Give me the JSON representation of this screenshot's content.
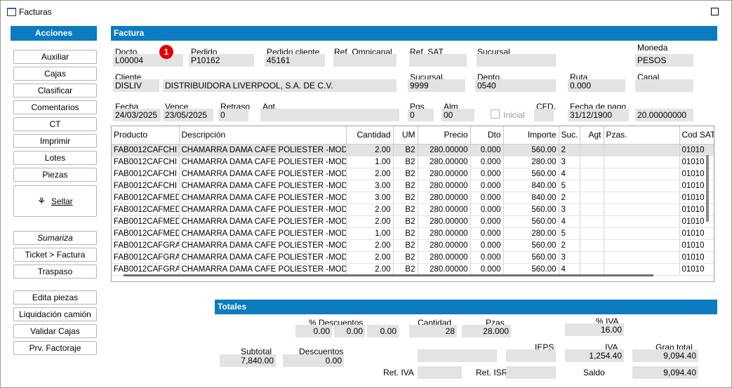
{
  "window": {
    "title": "Facturas"
  },
  "sidebar": {
    "header": "Acciones",
    "group1": [
      "Auxiliar",
      "Cajas",
      "Clasificar",
      "Comentarios",
      "CT",
      "Imprimir",
      "Lotes",
      "Piezas"
    ],
    "sellar": "Sellar",
    "group2": [
      "Sumariza",
      "Ticket > Factura",
      "Traspaso"
    ],
    "group3": [
      "Edita piezas",
      "Liquidación camión",
      "Validar Cajas",
      "Prv. Factoraje"
    ]
  },
  "factura": {
    "header": "Factura",
    "badge": "1",
    "docto_label": "Docto.",
    "docto": "L00004",
    "pedido_label": "Pedido",
    "pedido": "P10162",
    "pedido_cliente_label": "Pedido cliente",
    "pedido_cliente": "45161",
    "ref_omni_label": "Ref. Omnicanal",
    "ref_omni": "",
    "ref_sat_label": "Ref. SAT",
    "ref_sat": "",
    "sucursal_label": "Sucursal",
    "sucursal": "",
    "moneda_label": "Moneda",
    "moneda": "PESOS",
    "cliente_label": "Cliente",
    "cliente_code": "DISLIV",
    "cliente_name": "DISTRIBUIDORA LIVERPOOL, S.A. DE C.V.",
    "sucursal2_label": "Sucursal.",
    "sucursal2": "9999",
    "depto_label": "Depto.",
    "depto": "0540",
    "ruta_label": "Ruta.",
    "ruta": "0.000",
    "canal_label": "Canal",
    "canal": "",
    "fecha_label": "Fecha",
    "fecha": "24/03/2025",
    "vence_label": "Vence",
    "vence": "23/05/2025",
    "retraso_label": "Retraso",
    "retraso": "0",
    "agt_label": "Agt.",
    "agt": "",
    "pgs_label": "Pgs.",
    "pgs": "0",
    "alm_label": "Alm.",
    "alm": "00",
    "inicial_label": "Inicial",
    "cfd_label": "CFD.",
    "cfd": "",
    "fecha_pago_label": "Fecha de pago",
    "fecha_pago": "31/12/1900",
    "tipo_cambio": "20.00000000"
  },
  "grid": {
    "columns": [
      "Producto",
      "Descripción",
      "Cantidad",
      "UM",
      "Precio",
      "Dto",
      "Importe",
      "Suc.",
      "Agt",
      "Pzas.",
      "Cod SAT"
    ],
    "rows": [
      [
        "FAB0012CAFCHI",
        "CHAMARRA DAMA CAFE POLIESTER  -MOD",
        "2.00",
        "B2",
        "280.00000",
        "0.000",
        "560.00",
        "2",
        "",
        "",
        "01010"
      ],
      [
        "FAB0012CAFCHI",
        "CHAMARRA DAMA CAFE POLIESTER  -MOD",
        "1.00",
        "B2",
        "280.00000",
        "0.000",
        "280.00",
        "3",
        "",
        "",
        "01010"
      ],
      [
        "FAB0012CAFCHI",
        "CHAMARRA DAMA CAFE POLIESTER  -MOD",
        "2.00",
        "B2",
        "280.00000",
        "0.000",
        "560.00",
        "4",
        "",
        "",
        "01010"
      ],
      [
        "FAB0012CAFCHI",
        "CHAMARRA DAMA CAFE POLIESTER  -MOD",
        "3.00",
        "B2",
        "280.00000",
        "0.000",
        "840.00",
        "5",
        "",
        "",
        "01010"
      ],
      [
        "FAB0012CAFMED",
        "CHAMARRA DAMA CAFE POLIESTER  -MOD",
        "3.00",
        "B2",
        "280.00000",
        "0.000",
        "840.00",
        "2",
        "",
        "",
        "01010"
      ],
      [
        "FAB0012CAFMED",
        "CHAMARRA DAMA CAFE POLIESTER  -MOD",
        "2.00",
        "B2",
        "280.00000",
        "0.000",
        "560.00",
        "3",
        "",
        "",
        "01010"
      ],
      [
        "FAB0012CAFMED",
        "CHAMARRA DAMA CAFE POLIESTER  -MOD",
        "2.00",
        "B2",
        "280.00000",
        "0.000",
        "560.00",
        "4",
        "",
        "",
        "01010"
      ],
      [
        "FAB0012CAFMED",
        "CHAMARRA DAMA CAFE POLIESTER  -MOD",
        "1.00",
        "B2",
        "280.00000",
        "0.000",
        "280.00",
        "5",
        "",
        "",
        "01010"
      ],
      [
        "FAB0012CAFGRA",
        "CHAMARRA DAMA CAFE POLIESTER  -MOD",
        "2.00",
        "B2",
        "280.00000",
        "0.000",
        "560.00",
        "2",
        "",
        "",
        "01010"
      ],
      [
        "FAB0012CAFGRA",
        "CHAMARRA DAMA CAFE POLIESTER  -MOD",
        "2.00",
        "B2",
        "280.00000",
        "0.000",
        "560.00",
        "3",
        "",
        "",
        "01010"
      ],
      [
        "FAB0012CAFGRA",
        "CHAMARRA DAMA CAFE POLIESTER  -MOD",
        "2.00",
        "B2",
        "280.00000",
        "0.000",
        "560.00",
        "4",
        "",
        "",
        "01010"
      ]
    ]
  },
  "totales": {
    "header": "Totales",
    "descuentos_pct_label": "% Descuentos",
    "desc1": "0.00",
    "desc2": "0.00",
    "desc3": "0.00",
    "cantidad_label": "Cantidad",
    "cantidad": "28",
    "pzas_label": "Pzas.",
    "pzas": "28.000",
    "iva_pct_label": "% IVA",
    "iva_pct": "16.00",
    "subtotal_label": "Subtotal",
    "subtotal": "7,840.00",
    "descuentos_label": "Descuentos",
    "descuentos": "0.00",
    "ieps_label": "IEPS",
    "ieps": "",
    "iva_label": "IVA",
    "iva": "1,254.40",
    "gran_total_label": "Gran total",
    "gran_total": "9,094.40",
    "ret_iva_label": "Ret. IVA",
    "ret_iva": "",
    "ret_isr_label": "Ret. ISR",
    "ret_isr": "",
    "saldo_label": "Saldo",
    "saldo": "9,094.40"
  },
  "colors": {
    "accent": "#0c7bc0",
    "field": "#e3e3e3",
    "badge": "#e00000"
  }
}
